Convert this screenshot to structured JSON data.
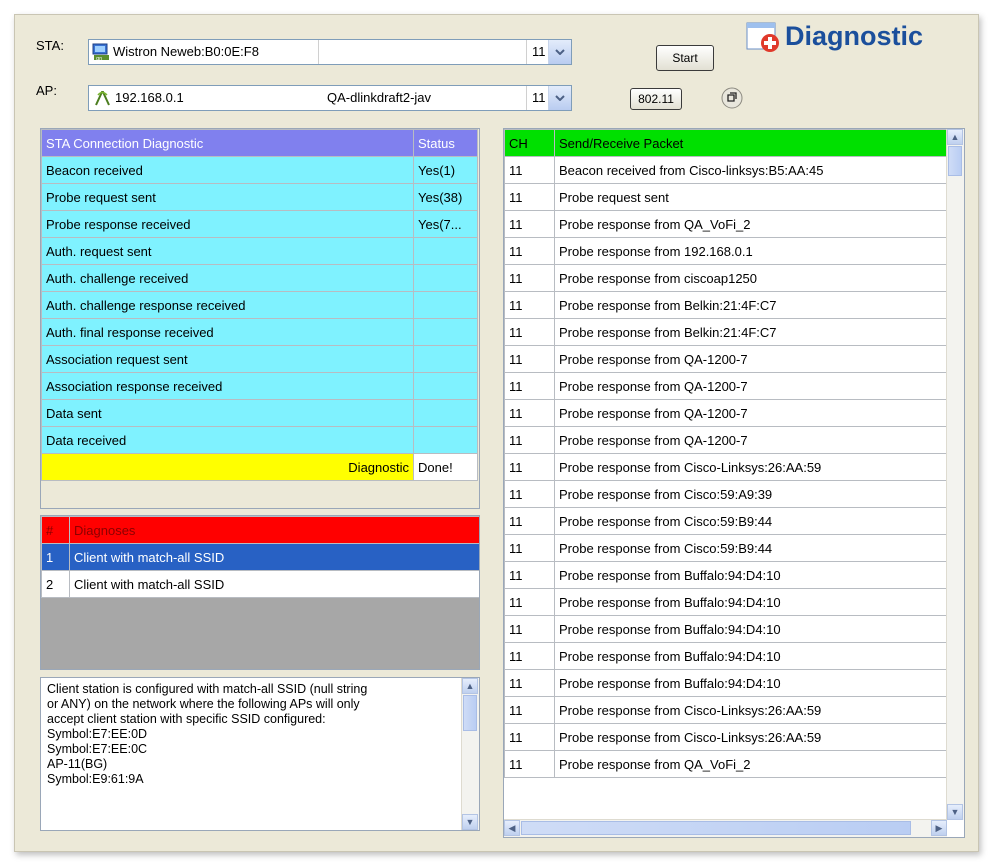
{
  "header": {
    "sta_label": "STA:",
    "sta_device": "Wistron Neweb:B0:0E:F8",
    "sta_channel": "11",
    "ap_label": "AP:",
    "ap_address": "192.168.0.1",
    "ap_ssid": "QA-dlinkdraft2-jav",
    "ap_channel": "11",
    "start_button": "Start",
    "standard_button": "802.11",
    "title": "Diagnostic"
  },
  "connection": {
    "col_step": "STA Connection Diagnostic",
    "col_status": "Status",
    "rows": [
      {
        "step": "Beacon received",
        "status": "Yes(1)"
      },
      {
        "step": "Probe request sent",
        "status": "Yes(38)"
      },
      {
        "step": "Probe response received",
        "status": "Yes(7..."
      },
      {
        "step": "Auth. request sent",
        "status": ""
      },
      {
        "step": "Auth. challenge received",
        "status": ""
      },
      {
        "step": "Auth. challenge response received",
        "status": ""
      },
      {
        "step": "Auth. final response received",
        "status": ""
      },
      {
        "step": "Association request sent",
        "status": ""
      },
      {
        "step": "Association response received",
        "status": ""
      },
      {
        "step": "Data sent",
        "status": ""
      },
      {
        "step": "Data received",
        "status": ""
      }
    ],
    "footer_label": "Diagnostic",
    "footer_value": "Done!"
  },
  "diagnoses": {
    "col_num": "#",
    "col_name": "Diagnoses",
    "rows": [
      {
        "num": "1",
        "name": "Client with match-all SSID"
      },
      {
        "num": "2",
        "name": "Client with match-all SSID"
      }
    ],
    "selected_index": 0
  },
  "description": {
    "lines": [
      "Client station is configured with match-all SSID (null string",
      "or ANY) on the network where the following APs will only",
      "accept client station with specific SSID configured:",
      "Symbol:E7:EE:0D",
      "Symbol:E7:EE:0C",
      "AP-11(BG)",
      "Symbol:E9:61:9A"
    ]
  },
  "packets": {
    "col_ch": "CH",
    "col_packet": "Send/Receive Packet",
    "rows": [
      {
        "ch": "11",
        "packet": "Beacon received from Cisco-linksys:B5:AA:45"
      },
      {
        "ch": "11",
        "packet": "Probe request sent"
      },
      {
        "ch": "11",
        "packet": "Probe response from QA_VoFi_2"
      },
      {
        "ch": "11",
        "packet": "Probe response from 192.168.0.1"
      },
      {
        "ch": "11",
        "packet": "Probe response from ciscoap1250"
      },
      {
        "ch": "11",
        "packet": "Probe response from Belkin:21:4F:C7"
      },
      {
        "ch": "11",
        "packet": "Probe response from Belkin:21:4F:C7"
      },
      {
        "ch": "11",
        "packet": "Probe response from QA-1200-7"
      },
      {
        "ch": "11",
        "packet": "Probe response from QA-1200-7"
      },
      {
        "ch": "11",
        "packet": "Probe response from QA-1200-7"
      },
      {
        "ch": "11",
        "packet": "Probe response from QA-1200-7"
      },
      {
        "ch": "11",
        "packet": "Probe response from Cisco-Linksys:26:AA:59"
      },
      {
        "ch": "11",
        "packet": "Probe response from Cisco:59:A9:39"
      },
      {
        "ch": "11",
        "packet": "Probe response from Cisco:59:B9:44"
      },
      {
        "ch": "11",
        "packet": "Probe response from Cisco:59:B9:44"
      },
      {
        "ch": "11",
        "packet": "Probe response from Buffalo:94:D4:10"
      },
      {
        "ch": "11",
        "packet": "Probe response from Buffalo:94:D4:10"
      },
      {
        "ch": "11",
        "packet": "Probe response from Buffalo:94:D4:10"
      },
      {
        "ch": "11",
        "packet": "Probe response from Buffalo:94:D4:10"
      },
      {
        "ch": "11",
        "packet": "Probe response from Buffalo:94:D4:10"
      },
      {
        "ch": "11",
        "packet": "Probe response from Cisco-Linksys:26:AA:59"
      },
      {
        "ch": "11",
        "packet": "Probe response from Cisco-Linksys:26:AA:59"
      },
      {
        "ch": "11",
        "packet": "Probe response from QA_VoFi_2"
      }
    ]
  },
  "colors": {
    "connection_header": "#8080ee",
    "connection_rows": "#7ff2ff",
    "diagnostic_footer": "#ffff00",
    "packets_header": "#00e000",
    "diagnoses_header": "#ff0000",
    "selected_row": "#2861c4"
  },
  "icons": {
    "sta_icon": "network-adapter-icon",
    "ap_icon": "access-point-icon",
    "title_icon": "diagnostic-window-icon",
    "refresh_icon": "refresh-icon"
  }
}
